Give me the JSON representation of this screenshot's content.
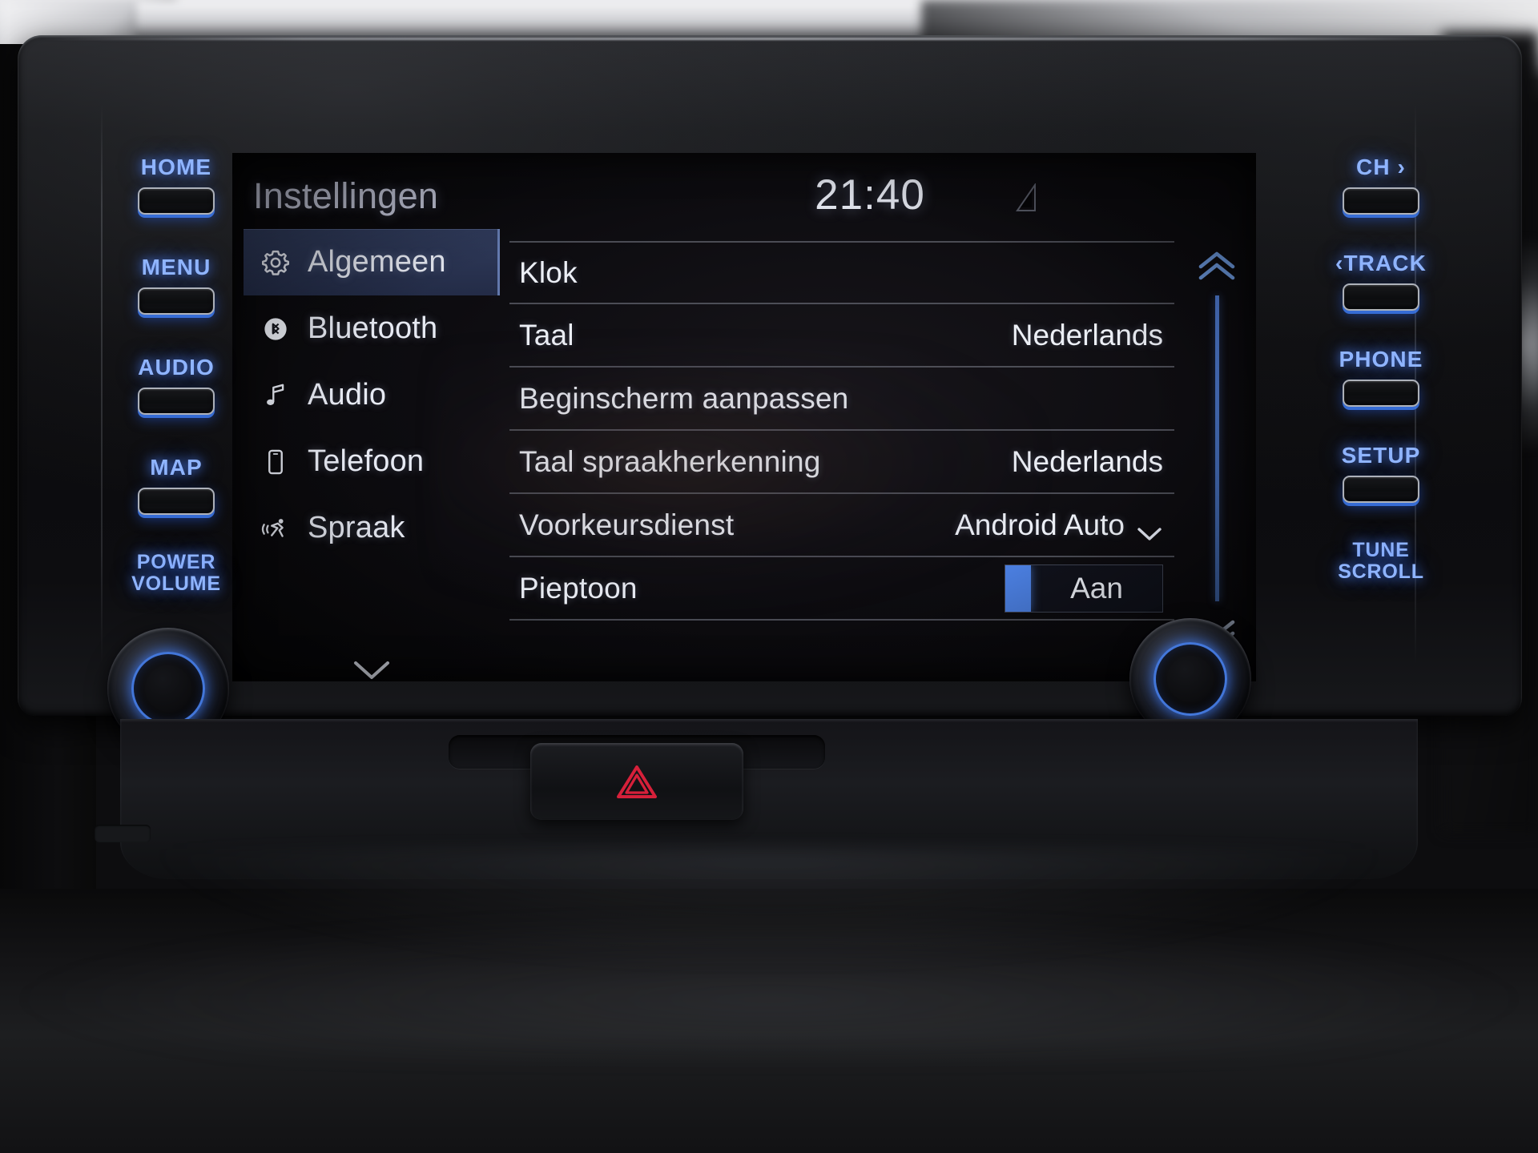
{
  "screen": {
    "title": "Instellingen",
    "clock": "21:40",
    "signal_icon": "signal-bars-icon"
  },
  "nav": {
    "items": [
      {
        "label": "Algemeen",
        "icon": "gear-icon",
        "active": true
      },
      {
        "label": "Bluetooth",
        "icon": "bluetooth-icon",
        "active": false
      },
      {
        "label": "Audio",
        "icon": "music-note-icon",
        "active": false
      },
      {
        "label": "Telefoon",
        "icon": "phone-icon",
        "active": false
      },
      {
        "label": "Spraak",
        "icon": "voice-icon",
        "active": false
      }
    ],
    "more_icon": "chevron-down-icon"
  },
  "settings": {
    "rows": [
      {
        "label": "Klok",
        "value": "",
        "type": "link"
      },
      {
        "label": "Taal",
        "value": "Nederlands",
        "type": "value"
      },
      {
        "label": "Beginscherm aanpassen",
        "value": "",
        "type": "link"
      },
      {
        "label": "Taal spraakherkenning",
        "value": "Nederlands",
        "type": "value"
      },
      {
        "label": "Voorkeursdienst",
        "value": "Android Auto",
        "type": "dropdown"
      },
      {
        "label": "Pieptoon",
        "value": "Aan",
        "type": "toggle"
      }
    ]
  },
  "scroll": {
    "up_icon": "double-chevron-up-icon",
    "down_icon": "double-chevron-down-icon"
  },
  "hardware": {
    "left_buttons": [
      {
        "label": "HOME"
      },
      {
        "label": "MENU"
      },
      {
        "label": "AUDIO"
      },
      {
        "label": "MAP"
      },
      {
        "label": "POWER\nVOLUME",
        "knob": true
      }
    ],
    "right_buttons": [
      {
        "label": "CH ›"
      },
      {
        "label": "‹TRACK"
      },
      {
        "label": "PHONE"
      },
      {
        "label": "SETUP"
      },
      {
        "label": "TUNE\nSCROLL",
        "knob": true
      }
    ]
  },
  "dash": {
    "hazard_icon": "hazard-triangle-icon"
  },
  "colors": {
    "accent_blue": "#4a7ddd",
    "button_backlight": "#8fb4ff",
    "screen_text": "#eceff6",
    "title_text": "#c9ccdf",
    "hazard_red": "#d6203a"
  }
}
